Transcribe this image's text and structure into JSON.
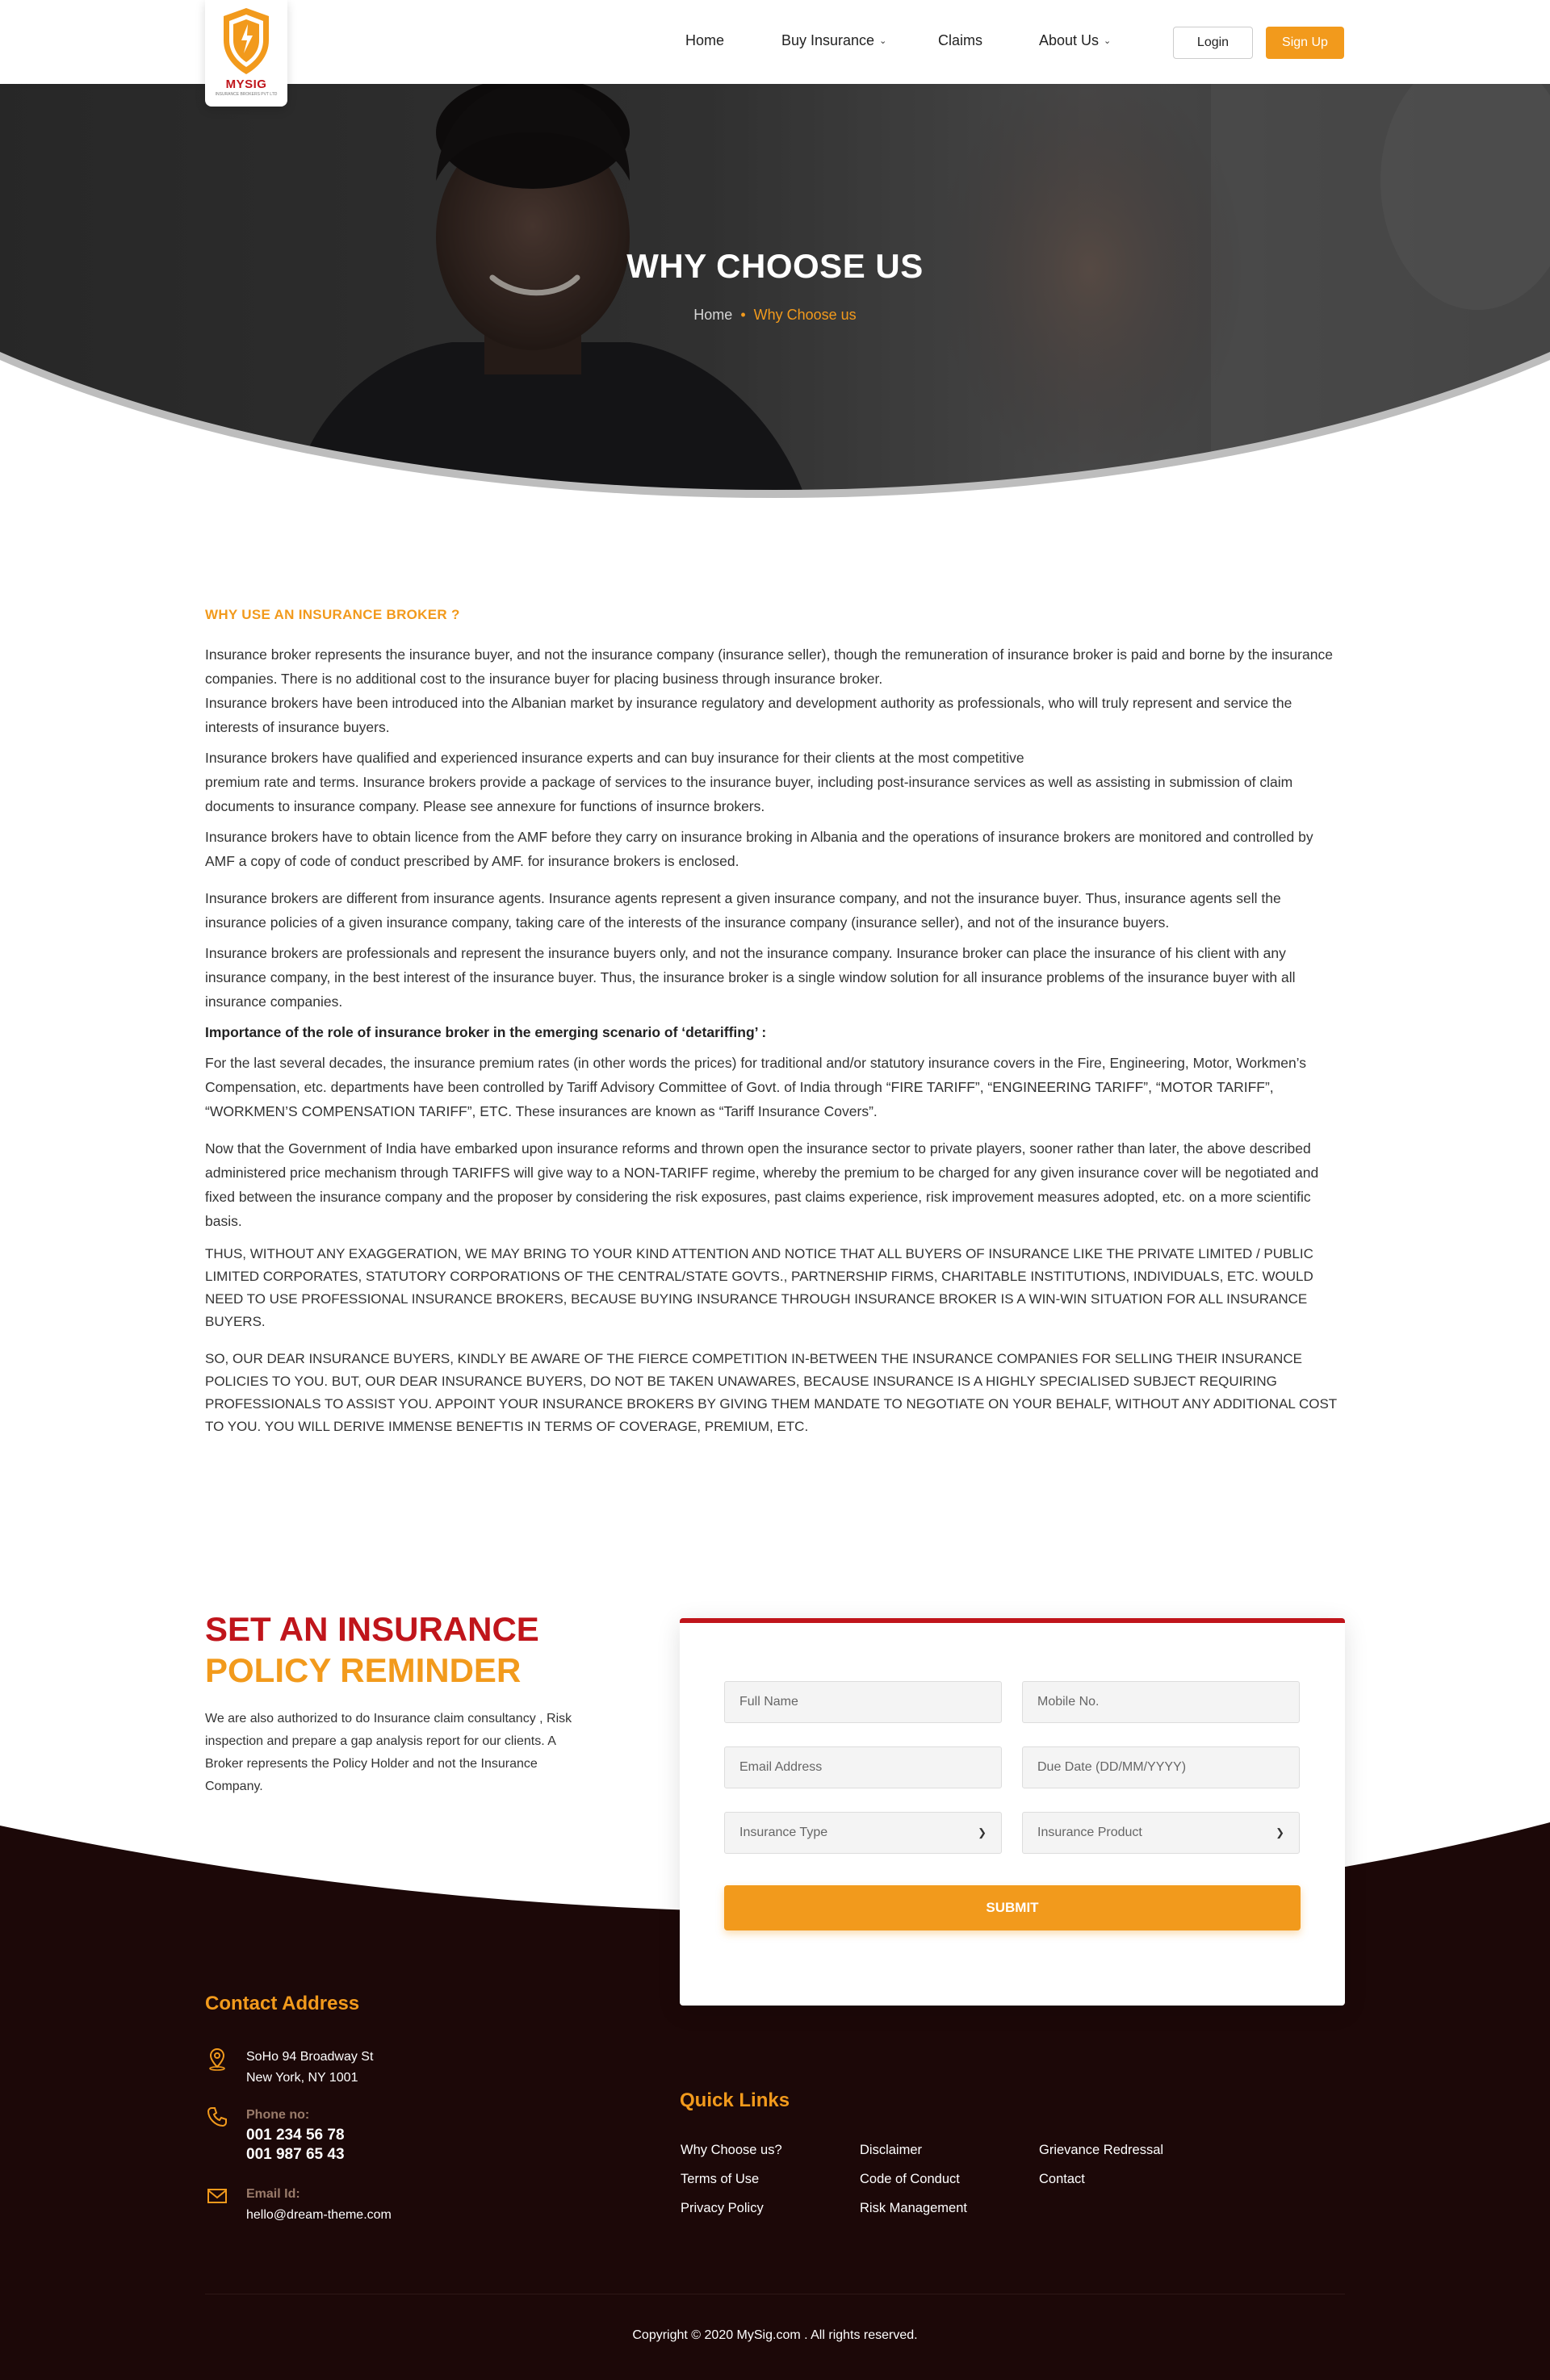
{
  "brand": {
    "name": "MYSIG",
    "tagline": "INSURANCE BROKERS PVT LTD"
  },
  "nav": {
    "home": "Home",
    "buy_insurance": "Buy Insurance",
    "claims": "Claims",
    "about_us": "About Us",
    "login": "Login",
    "signup": "Sign Up"
  },
  "hero": {
    "title": "WHY CHOOSE US",
    "breadcrumb_home": "Home",
    "breadcrumb_current": "Why Choose us"
  },
  "article": {
    "heading": "WHY USE AN INSURANCE BROKER ?",
    "p1": "Insurance broker represents the insurance buyer, and not the insurance company (insurance seller), though the remuneration of insurance broker is paid and borne     by the insurance companies. There is no additional cost to the insurance buyer for placing business through insurance broker.",
    "p1b": "Insurance brokers have been introduced into the Albanian market by insurance regulatory and development authority as professionals, who will truly represent and service the interests of insurance buyers.",
    "p2a": "Insurance brokers have qualified and experienced insurance experts and can buy insurance for their clients at the most competitive",
    "p2b": "premium rate and terms. Insurance brokers provide a package of services to the insurance buyer, including post-insurance services as well as assisting in submission of claim documents to insurance company. Please see annexure for functions of insurnce brokers.",
    "p3": "Insurance brokers have to obtain licence from the AMF before they carry on insurance broking in Albania and the operations of insurance brokers are monitored and controlled by AMF a copy of code of conduct prescribed by AMF. for insurance brokers is enclosed.",
    "p4": "Insurance brokers are different from insurance agents. Insurance agents represent a given insurance company, and not the insurance buyer. Thus, insurance agents sell the insurance policies of a given insurance company, taking care of the interests of the insurance company (insurance seller), and not of the insurance buyers.",
    "p5": "Insurance brokers are professionals and represent the insurance buyers only, and not the insurance company. Insurance broker can place the insurance of his client with any insurance company, in the best interest of the insurance buyer. Thus, the insurance broker is a single window solution for all insurance problems of the insurance buyer with all insurance companies.",
    "p6": "Importance of the role of insurance broker in the emerging scenario of ‘detariffing’ :",
    "p7": "For the last several decades, the insurance premium rates (in other words the prices) for traditional and/or statutory insurance covers in the Fire, Engineering, Motor, Workmen’s Compensation, etc. departments have been controlled by Tariff Advisory Committee of Govt. of India through “FIRE TARIFF”, “ENGINEERING TARIFF”, “MOTOR TARIFF”, “WORKMEN’S COMPENSATION TARIFF”, ETC. These insurances are known as “Tariff Insurance Covers”.",
    "p8": "Now that the Government of India have embarked upon insurance reforms and thrown open the insurance sector to private players, sooner rather than later, the above described administered price mechanism through TARIFFS will give way to a NON-TARIFF regime, whereby the premium to be charged for any given insurance cover will be negotiated and fixed between the insurance company and the proposer by considering the risk exposures, past claims experience, risk improvement measures adopted, etc. on a more scientific basis.",
    "p9": "THUS, WITHOUT ANY EXAGGERATION, WE MAY BRING TO YOUR KIND ATTENTION AND NOTICE THAT ALL BUYERS OF INSURANCE LIKE THE PRIVATE LIMITED / PUBLIC LIMITED CORPORATES, STATUTORY CORPORATIONS OF THE CENTRAL/STATE GOVTS., PARTNERSHIP FIRMS, CHARITABLE INSTITUTIONS, INDIVIDUALS, ETC. WOULD NEED TO USE PROFESSIONAL INSURANCE BROKERS, BECAUSE BUYING INSURANCE THROUGH INSURANCE BROKER IS A WIN-WIN SITUATION FOR ALL INSURANCE BUYERS.",
    "p10": "SO, OUR DEAR INSURANCE BUYERS, KINDLY BE AWARE OF THE FIERCE COMPETITION IN-BETWEEN THE INSURANCE COMPANIES FOR SELLING THEIR INSURANCE POLICIES TO YOU. BUT, OUR DEAR INSURANCE BUYERS, DO NOT BE TAKEN UNAWARES, BECAUSE INSURANCE IS A HIGHLY SPECIALISED SUBJECT REQUIRING PROFESSIONALS TO ASSIST YOU. APPOINT YOUR INSURANCE BROKERS BY GIVING THEM MANDATE TO NEGOTIATE ON YOUR BEHALF, WITHOUT ANY ADDITIONAL COST TO YOU. YOU WILL DERIVE IMMENSE BENEFTIS IN TERMS OF COVERAGE, PREMIUM, ETC."
  },
  "reminder": {
    "title_line1": "SET AN INSURANCE",
    "title_line2": "POLICY REMINDER",
    "description": "We are also authorized to do Insurance claim consultancy , Risk inspection and prepare a gap analysis report for our clients. A Broker represents the Policy Holder and not the Insurance Company.",
    "form": {
      "full_name_placeholder": "Full Name",
      "mobile_placeholder": "Mobile No.",
      "email_placeholder": "Email Address",
      "due_date_placeholder": "Due Date (DD/MM/YYYY)",
      "insurance_type": "Insurance Type",
      "insurance_product": "Insurance Product",
      "submit": "SUBMIT"
    }
  },
  "footer": {
    "contact_heading": "Contact Address",
    "address_line1": "SoHo 94 Broadway St",
    "address_line2": "New York, NY 1001",
    "phone_label": "Phone no:",
    "phone1": "001 234 56 78",
    "phone2": "001 987 65 43",
    "email_label": "Email Id:",
    "email": "hello@dream-theme.com",
    "quick_links_heading": "Quick Links",
    "links": [
      "Why Choose us?",
      "Disclaimer",
      "Grievance Redressal",
      "Terms of Use",
      "Code of Conduct",
      "Contact",
      "Privacy Policy",
      "Risk Management"
    ],
    "copyright": "Copyright © 2020 MySig.com . All rights reserved."
  },
  "colors": {
    "accent_orange": "#f29a1c",
    "brand_red": "#c0151b",
    "footer_bg": "#1c0808"
  }
}
